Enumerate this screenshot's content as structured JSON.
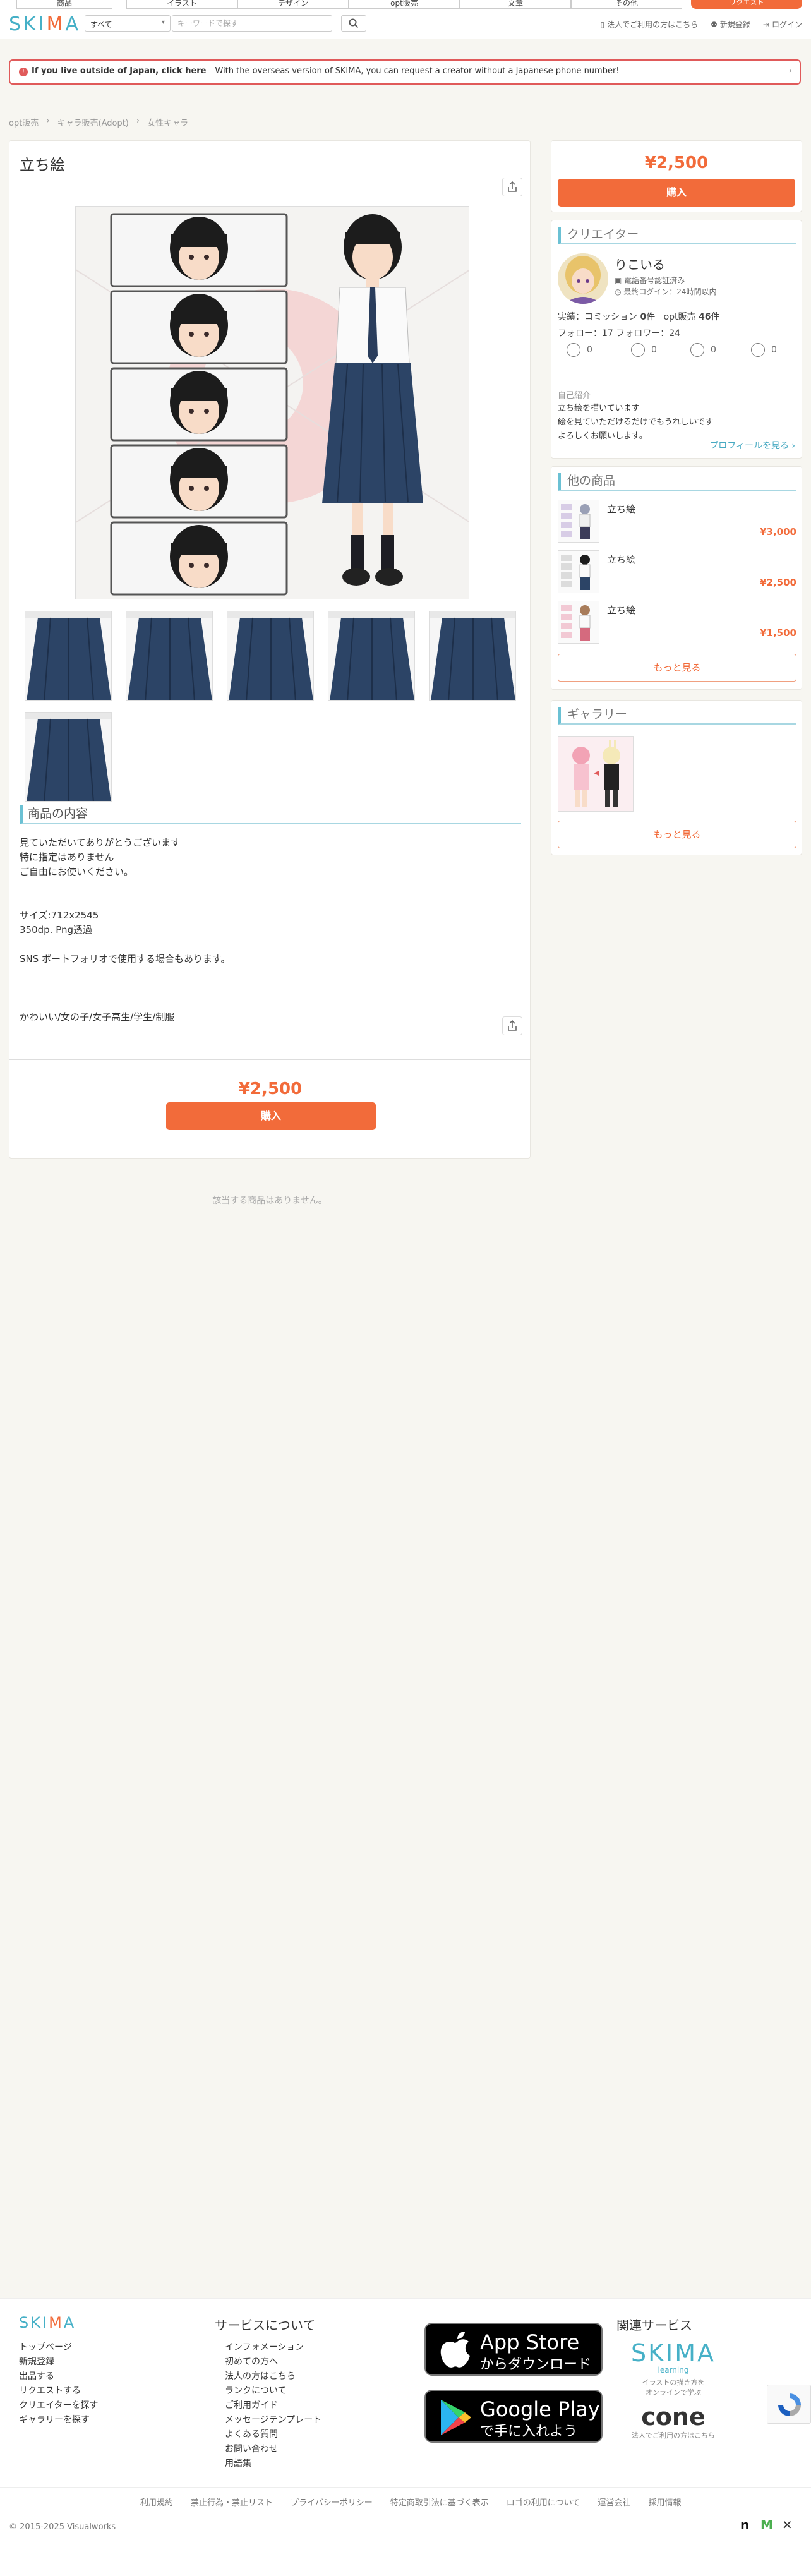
{
  "top_nav": {
    "tabs": [
      "商品",
      "イラスト",
      "デザイン",
      "opt販売",
      "文章",
      "その他"
    ],
    "cta_label": "リクエスト"
  },
  "header": {
    "logo": "SKIMA",
    "category_select": "すべて",
    "search_placeholder": "キーワードで探す",
    "links": [
      "法人でご利用の方はこちら",
      "新規登録",
      "ログイン"
    ]
  },
  "banner": {
    "bold": "If you live outside of Japan, click here",
    "text": "With the overseas version of SKIMA, you can request a creator without a Japanese phone number!"
  },
  "breadcrumb": [
    "opt販売",
    "キャラ販売(Adopt)",
    "女性キャラ"
  ],
  "product": {
    "title": "立ち絵",
    "section_title": "商品の内容",
    "description": [
      "見ていただいてありがとうございます",
      "特に指定はありません",
      "ご自由にお使いください。",
      "",
      "",
      "サイズ:712x2545",
      "350dp. Png透過",
      "",
      "SNS ポートフォリオで使用する場合もあります。",
      "",
      "",
      "",
      "かわいい/女の子/女子高生/学生/制服"
    ],
    "price": "¥2,500",
    "buy_label": "購入",
    "thumb_count": 6
  },
  "no_related": "該当する商品はありません。",
  "side": {
    "price": "¥2,500",
    "buy_label": "購入",
    "creator": {
      "heading": "クリエイター",
      "name": "りこいる",
      "verified": "電話番号認証済み",
      "last_login": "最終ログイン：24時間以内",
      "stats": {
        "commission_label": "実績：コミッション",
        "commission_count": "0",
        "commission_unit": "件",
        "opt_label": "opt販売",
        "opt_count": "46",
        "opt_unit": "件"
      },
      "follow": "フォロー：17 フォロワー：24",
      "reactions": [
        "0",
        "0",
        "0",
        "0"
      ],
      "intro_label": "自己紹介",
      "intro": [
        "立ち絵を描いています",
        "絵を見ていただけるだけでもうれしいです",
        "よろしくお願いします。"
      ],
      "profile_link": "プロフィールを見る ›"
    },
    "others": {
      "heading": "他の商品",
      "items": [
        {
          "title": "立ち絵",
          "price": "¥3,000"
        },
        {
          "title": "立ち絵",
          "price": "¥2,500"
        },
        {
          "title": "立ち絵",
          "price": "¥1,500"
        }
      ],
      "more": "もっと見る"
    },
    "gallery": {
      "heading": "ギャラリー",
      "more": "もっと見る"
    }
  },
  "footer": {
    "logo": "SKIMA",
    "left_links": [
      "トップページ",
      "新規登録",
      "出品する",
      "リクエストする",
      "クリエイターを探す",
      "ギャラリーを探す"
    ],
    "service_title": "サービスについて",
    "service_links": [
      "インフォメーション",
      "初めての方へ",
      "法人の方はこちら",
      "ランクについて",
      "ご利用ガイド",
      "メッセージテンプレート",
      "よくある質問",
      "お問い合わせ",
      "用語集"
    ],
    "app_store": {
      "big": "App Store",
      "small": "からダウンロード"
    },
    "google_play": {
      "big": "Google Play",
      "small": "で手に入れよう"
    },
    "related_title": "関連サービス",
    "skima_learning": {
      "name": "SKIMA",
      "sub": "learning",
      "desc1": "イラストの描き方を",
      "desc2": "オンラインで学ぶ"
    },
    "cone": {
      "name": "cone",
      "desc": "法人でご利用の方はこちら"
    },
    "bottom_links": [
      "利用規約",
      "禁止行為・禁止リスト",
      "プライバシーポリシー",
      "特定商取引法に基づく表示",
      "ロゴの利用について",
      "運営会社",
      "採用情報"
    ],
    "copyright": "© 2015-2025 Visualworks"
  },
  "colors": {
    "brand": "#46b0c7",
    "accent": "#f26b3a",
    "warning": "#e05a5a"
  }
}
